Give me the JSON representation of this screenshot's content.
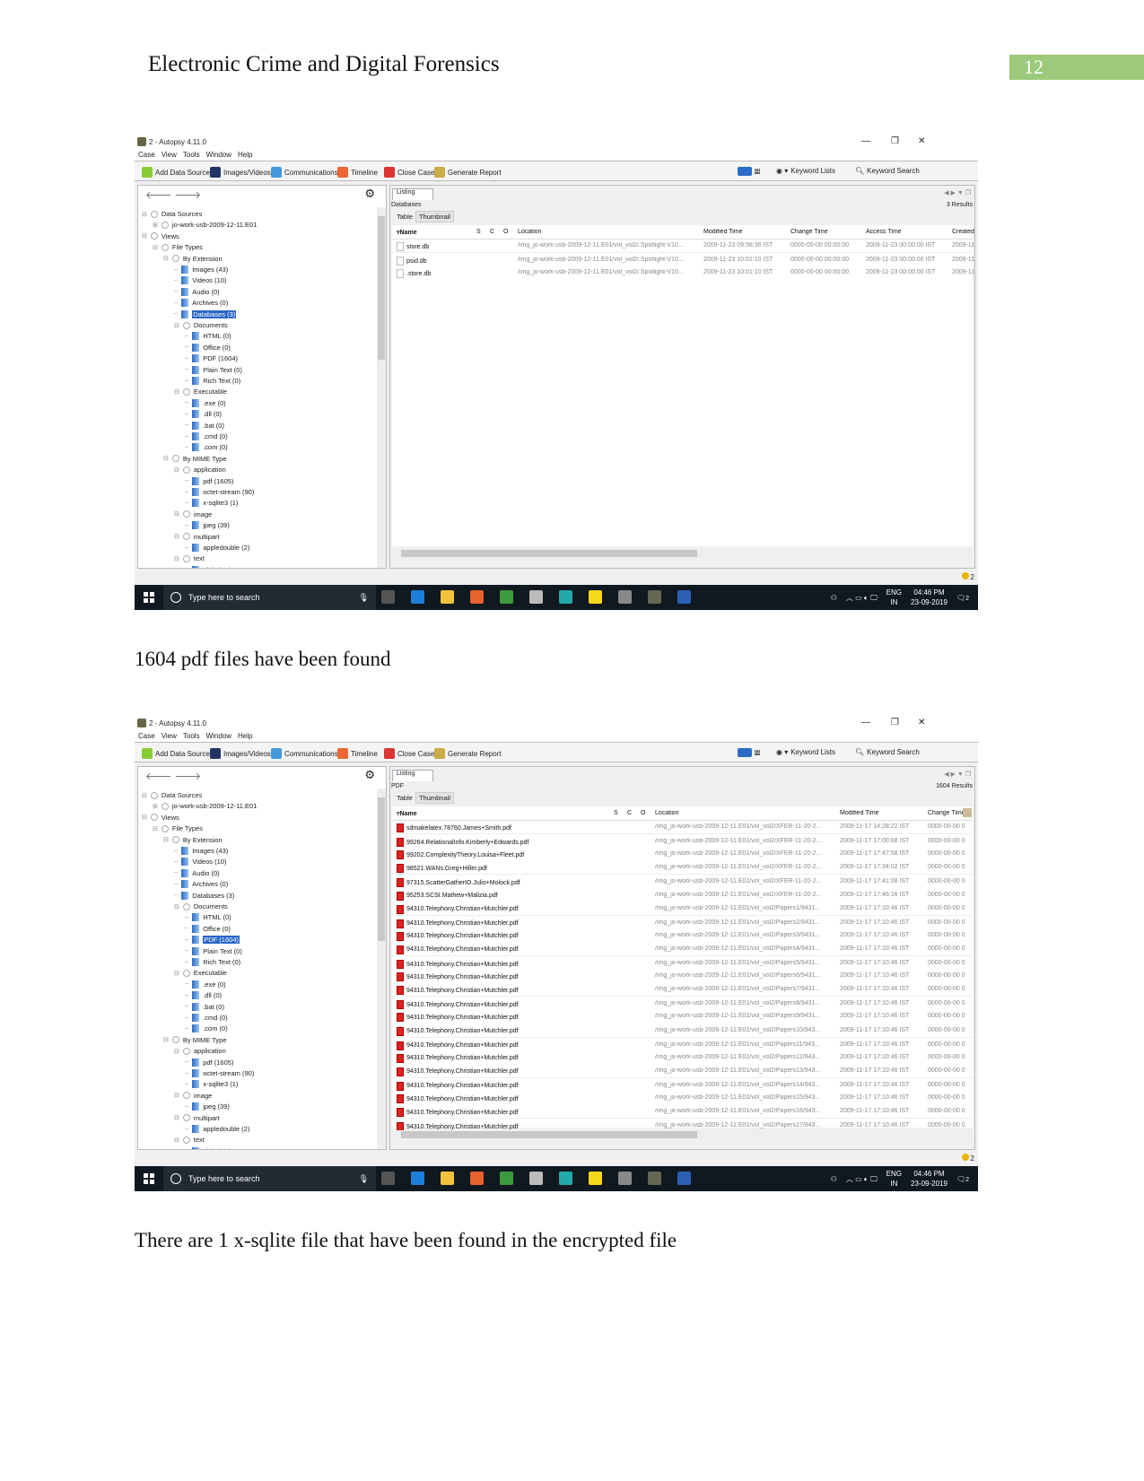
{
  "header": {
    "title": "Electronic Crime and Digital Forensics",
    "page_number": "12",
    "accent_color": "#9cc97a"
  },
  "captions": [
    "1604 pdf files have been found",
    "There are 1 x-sqlite file that have been found in the encrypted file"
  ],
  "app": {
    "window_title": "2 - Autopsy 4.11.0",
    "menu": [
      "Case",
      "View",
      "Tools",
      "Window",
      "Help"
    ],
    "toolbar": [
      "Add Data Source",
      "Images/Videos",
      "Communications",
      "Timeline",
      "Close Case",
      "Generate Report"
    ],
    "keyword_lists": "Keyword Lists",
    "keyword_search": "Keyword Search",
    "mail_count": "11",
    "listing_tab": "Listing",
    "view_tabs": [
      "Table",
      "Thumbnail"
    ],
    "status_badge": "2",
    "taskbar": {
      "search_placeholder": "Type here to search",
      "lang": "ENG",
      "region": "IN",
      "time": "04:46 PM",
      "date": "23-09-2019",
      "notifications": "2"
    }
  },
  "tree": [
    {
      "l": 0,
      "label": "Data Sources",
      "exp": "⊟",
      "icon": "drive"
    },
    {
      "l": 1,
      "label": "jo-work-usb-2009-12-11.E01",
      "exp": "⊞",
      "icon": "drive"
    },
    {
      "l": 0,
      "label": "Views",
      "exp": "⊟",
      "icon": "eye"
    },
    {
      "l": 1,
      "label": "File Types",
      "exp": "⊟",
      "icon": "group"
    },
    {
      "l": 2,
      "label": "By Extension",
      "exp": "⊟",
      "icon": "group"
    },
    {
      "l": 3,
      "label": "Images (43)",
      "icon": "node"
    },
    {
      "l": 3,
      "label": "Videos (10)",
      "icon": "node"
    },
    {
      "l": 3,
      "label": "Audio (0)",
      "icon": "node"
    },
    {
      "l": 3,
      "label": "Archives (0)",
      "icon": "node"
    },
    {
      "l": 3,
      "label": "Databases (3)",
      "icon": "node"
    },
    {
      "l": 3,
      "label": "Documents",
      "exp": "⊟",
      "icon": "group"
    },
    {
      "l": 4,
      "label": "HTML (0)",
      "icon": "node"
    },
    {
      "l": 4,
      "label": "Office (0)",
      "icon": "node"
    },
    {
      "l": 4,
      "label": "PDF (1604)",
      "icon": "node"
    },
    {
      "l": 4,
      "label": "Plain Text (0)",
      "icon": "node"
    },
    {
      "l": 4,
      "label": "Rich Text (0)",
      "icon": "node"
    },
    {
      "l": 3,
      "label": "Executable",
      "exp": "⊟",
      "icon": "group"
    },
    {
      "l": 4,
      "label": ".exe (0)",
      "icon": "node"
    },
    {
      "l": 4,
      "label": ".dll (0)",
      "icon": "node"
    },
    {
      "l": 4,
      "label": ".bat (0)",
      "icon": "node"
    },
    {
      "l": 4,
      "label": ".cmd (0)",
      "icon": "node"
    },
    {
      "l": 4,
      "label": ".com (0)",
      "icon": "node"
    },
    {
      "l": 2,
      "label": "By MIME Type",
      "exp": "⊟",
      "icon": "group"
    },
    {
      "l": 3,
      "label": "application",
      "exp": "⊟",
      "icon": "group"
    },
    {
      "l": 4,
      "label": "pdf (1605)",
      "icon": "node"
    },
    {
      "l": 4,
      "label": "octet-stream (90)",
      "icon": "node"
    },
    {
      "l": 4,
      "label": "x-sqlite3 (1)",
      "icon": "node"
    },
    {
      "l": 3,
      "label": "image",
      "exp": "⊟",
      "icon": "group"
    },
    {
      "l": 4,
      "label": "jpeg (39)",
      "icon": "node"
    },
    {
      "l": 3,
      "label": "multipart",
      "exp": "⊟",
      "icon": "group"
    },
    {
      "l": 4,
      "label": "appledouble (2)",
      "icon": "node"
    },
    {
      "l": 3,
      "label": "text",
      "exp": "⊟",
      "icon": "group"
    },
    {
      "l": 4,
      "label": "plain (13)",
      "icon": "node"
    }
  ],
  "screenshots": [
    {
      "selected_tree_item": "Databases (3)",
      "breadcrumb": "Databases",
      "results": "3 Results",
      "file_icon": "file",
      "columns": [
        "Name",
        "S",
        "C",
        "O",
        "Location",
        "Modified Time",
        "Change Time",
        "Access Time",
        "Created"
      ],
      "rows": [
        [
          "store.db",
          "",
          "",
          "",
          "/img_jo-work-usb-2009-12-11.E01/vol_vol2/.Spotlight-V10...",
          "2009-11-23 09:58:36 IST",
          "0000-00-00 00:00:00",
          "2009-11-23 00:00:00 IST",
          "2009-11-"
        ],
        [
          "psid.db",
          "",
          "",
          "",
          "/img_jo-work-usb-2009-12-11.E01/vol_vol2/.Spotlight-V10...",
          "2009-11-23 10:01:10 IST",
          "0000-00-00 00:00:00",
          "2009-11-23 00:00:00 IST",
          "2009-11-"
        ],
        [
          ".store.db",
          "",
          "",
          "",
          "/img_jo-work-usb-2009-12-11.E01/vol_vol2/.Spotlight-V10...",
          "2009-11-23 10:01:10 IST",
          "0000-00-00 00:00:00",
          "2009-11-23 00:00:00 IST",
          "2009-11-"
        ]
      ]
    },
    {
      "selected_tree_item": "PDF (1604)",
      "breadcrumb": "PDF",
      "results": "1604 Results",
      "file_icon": "pdf",
      "columns": [
        "Name",
        "S",
        "C",
        "O",
        "Location",
        "Modified Time",
        "Change Time"
      ],
      "rows": [
        [
          "sdmakelatex.78760.James+Smith.pdf",
          "",
          "",
          "",
          "/img_jo-work-usb-2009-12-11.E01/vol_vol2/XFER-11-20-2...",
          "2009-11-17 14:28:22 IST",
          "0000-00-00 0"
        ],
        [
          "99264.RelationalInfo.Kimberly+Edwards.pdf",
          "",
          "",
          "",
          "/img_jo-work-usb-2009-12-11.E01/vol_vol2/XFER-11-20-2...",
          "2009-11-17 17:00:08 IST",
          "0000-00-00 0"
        ],
        [
          "99202.ComplexityTheory.Louisa+Fleet.pdf",
          "",
          "",
          "",
          "/img_jo-work-usb-2009-12-11.E01/vol_vol2/XFER-11-20-2...",
          "2009-11-17 17:47:58 IST",
          "0000-00-00 0"
        ],
        [
          "98521.WANs.Greg+Hiller.pdf",
          "",
          "",
          "",
          "/img_jo-work-usb-2009-12-11.E01/vol_vol2/XFER-11-20-2...",
          "2009-11-17 17:34:02 IST",
          "0000-00-00 0"
        ],
        [
          "97315.ScatterGatherIO.Julio+Molock.pdf",
          "",
          "",
          "",
          "/img_jo-work-usb-2009-12-11.E01/vol_vol2/XFER-11-20-2...",
          "2009-11-17 17:41:08 IST",
          "0000-00-00 0"
        ],
        [
          "95253.SCSI.Mathew+Malizia.pdf",
          "",
          "",
          "",
          "/img_jo-work-usb-2009-12-11.E01/vol_vol2/XFER-11-20-2...",
          "2009-11-17 17:46:16 IST",
          "0000-00-00 0"
        ],
        [
          "94310.Telephony.Christian+Mutchler.pdf",
          "",
          "",
          "",
          "/img_jo-work-usb-2009-12-11.E01/vol_vol2/Papers1/9431...",
          "2009-11-17 17:10:46 IST",
          "0000-00-00 0"
        ],
        [
          "94310.Telephony.Christian+Mutchler.pdf",
          "",
          "",
          "",
          "/img_jo-work-usb-2009-12-11.E01/vol_vol2/Papers2/9431...",
          "2009-11-17 17:10:46 IST",
          "0000-00-00 0"
        ],
        [
          "94310.Telephony.Christian+Mutchler.pdf",
          "",
          "",
          "",
          "/img_jo-work-usb-2009-12-11.E01/vol_vol2/Papers3/9431...",
          "2009-11-17 17:10:46 IST",
          "0000-00-00 0"
        ],
        [
          "94310.Telephony.Christian+Mutchler.pdf",
          "",
          "",
          "",
          "/img_jo-work-usb-2009-12-11.E01/vol_vol2/Papers4/9431...",
          "2009-11-17 17:10:46 IST",
          "0000-00-00 0"
        ],
        [
          "94310.Telephony.Christian+Mutchler.pdf",
          "",
          "",
          "",
          "/img_jo-work-usb-2009-12-11.E01/vol_vol2/Papers5/9431...",
          "2009-11-17 17:10:46 IST",
          "0000-00-00 0"
        ],
        [
          "94310.Telephony.Christian+Mutchler.pdf",
          "",
          "",
          "",
          "/img_jo-work-usb-2009-12-11.E01/vol_vol2/Papers6/9431...",
          "2009-11-17 17:10:46 IST",
          "0000-00-00 0"
        ],
        [
          "94310.Telephony.Christian+Mutchler.pdf",
          "",
          "",
          "",
          "/img_jo-work-usb-2009-12-11.E01/vol_vol2/Papers7/9431...",
          "2009-11-17 17:10:46 IST",
          "0000-00-00 0"
        ],
        [
          "94310.Telephony.Christian+Mutchler.pdf",
          "",
          "",
          "",
          "/img_jo-work-usb-2009-12-11.E01/vol_vol2/Papers8/9431...",
          "2009-11-17 17:10:46 IST",
          "0000-00-00 0"
        ],
        [
          "94310.Telephony.Christian+Mutchler.pdf",
          "",
          "",
          "",
          "/img_jo-work-usb-2009-12-11.E01/vol_vol2/Papers9/9431...",
          "2009-11-17 17:10:46 IST",
          "0000-00-00 0"
        ],
        [
          "94310.Telephony.Christian+Mutchler.pdf",
          "",
          "",
          "",
          "/img_jo-work-usb-2009-12-11.E01/vol_vol2/Papers10/943...",
          "2009-11-17 17:10:46 IST",
          "0000-00-00 0"
        ],
        [
          "94310.Telephony.Christian+Mutchler.pdf",
          "",
          "",
          "",
          "/img_jo-work-usb-2009-12-11.E01/vol_vol2/Papers11/943...",
          "2009-11-17 17:10:46 IST",
          "0000-00-00 0"
        ],
        [
          "94310.Telephony.Christian+Mutchler.pdf",
          "",
          "",
          "",
          "/img_jo-work-usb-2009-12-11.E01/vol_vol2/Papers12/943...",
          "2009-11-17 17:10:46 IST",
          "0000-00-00 0"
        ],
        [
          "94310.Telephony.Christian+Mutchler.pdf",
          "",
          "",
          "",
          "/img_jo-work-usb-2009-12-11.E01/vol_vol2/Papers13/943...",
          "2009-11-17 17:10:46 IST",
          "0000-00-00 0"
        ],
        [
          "94310.Telephony.Christian+Mutchler.pdf",
          "",
          "",
          "",
          "/img_jo-work-usb-2009-12-11.E01/vol_vol2/Papers14/943...",
          "2009-11-17 17:10:46 IST",
          "0000-00-00 0"
        ],
        [
          "94310.Telephony.Christian+Mutchler.pdf",
          "",
          "",
          "",
          "/img_jo-work-usb-2009-12-11.E01/vol_vol2/Papers15/943...",
          "2009-11-17 17:10:46 IST",
          "0000-00-00 0"
        ],
        [
          "94310.Telephony.Christian+Mutchler.pdf",
          "",
          "",
          "",
          "/img_jo-work-usb-2009-12-11.E01/vol_vol2/Papers16/943...",
          "2009-11-17 17:10:46 IST",
          "0000-00-00 0"
        ],
        [
          "94310.Telephony.Christian+Mutchler.pdf",
          "",
          "",
          "",
          "/img_jo-work-usb-2009-12-11.E01/vol_vol2/Papers17/943...",
          "2009-11-17 17:10:46 IST",
          "0000-00-00 0"
        ]
      ]
    }
  ]
}
